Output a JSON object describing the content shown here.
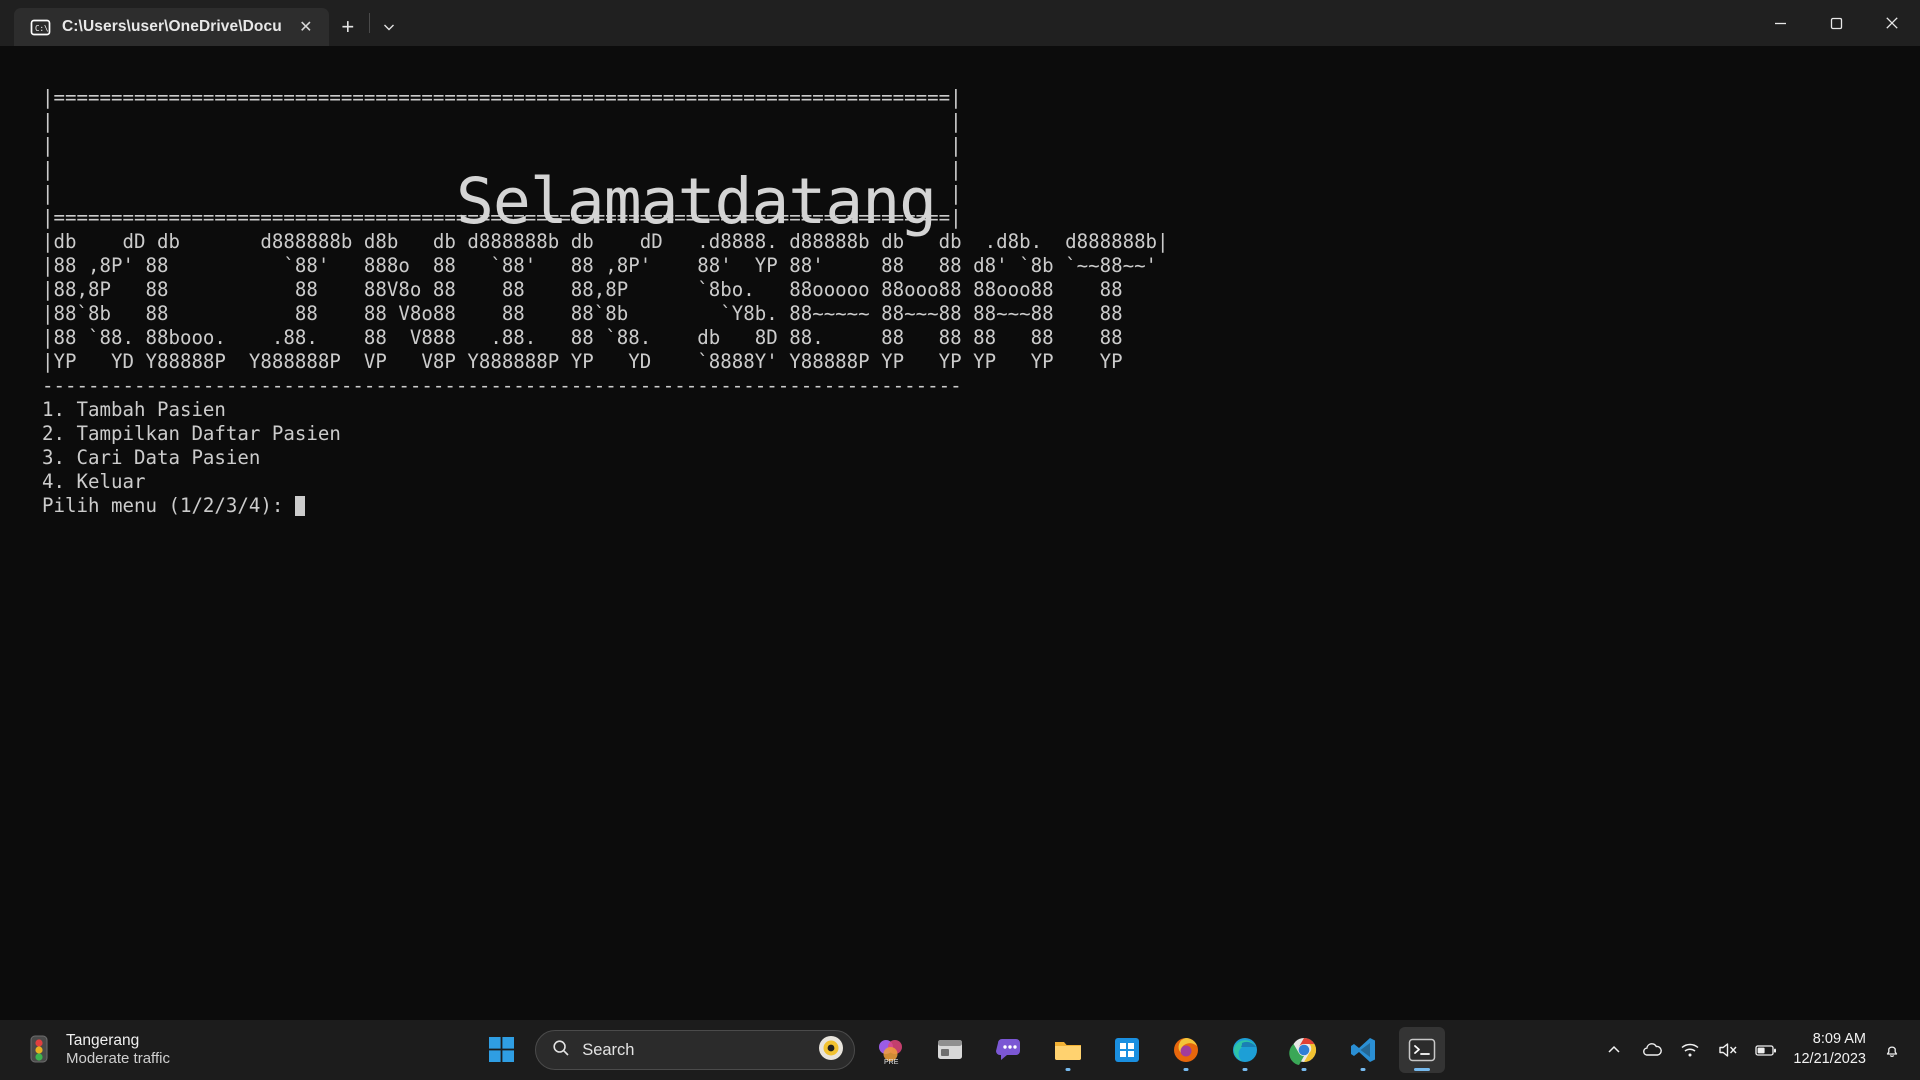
{
  "window": {
    "tab_title": "C:\\Users\\user\\OneDrive\\Docu",
    "tab_icon": "command-prompt-icon",
    "close_glyph": "✕",
    "newtab_glyph": "+",
    "dropdown_glyph": "⌄",
    "minimize_glyph": "─",
    "maximize_glyph": "☐",
    "winclose_glyph": "✕"
  },
  "terminal": {
    "background": "#0c0c0c",
    "foreground": "#cccccc",
    "banner_title": "Selamatdatang",
    "top_border": "|==============================================================================|",
    "blank_row": "|                                                                              |",
    "mid_border": "|==============================================================================|",
    "ascii_rows": [
      "|db    dD db       d888888b d8b   db d888888b db    dD   .d8888. d88888b db   db  .d8b.  d888888b|",
      "|88 ,8P' 88          `88'   888o  88   `88'   88 ,8P'    88'  YP 88'     88   88 d8' `8b `~~88~~'",
      "|88,8P   88           88    88V8o 88    88    88,8P      `8bo.   88ooooo 88ooo88 88ooo88    88   ",
      "|88`8b   88           88    88 V8o88    88    88`8b        `Y8b. 88~~~~~ 88~~~88 88~~~88    88   ",
      "|88 `88. 88booo.    .88.    88  V888   .88.   88 `88.    db   8D 88.     88   88 88   88    88   ",
      "|YP   YD Y88888P  Y888888P  VP   V8P Y888888P YP   YD    `8888Y' Y88888P YP   YP YP   YP    YP   "
    ],
    "separator": "--------------------------------------------------------------------------------",
    "menu_items": [
      "1. Tambah Pasien",
      "2. Tampilkan Daftar Pasien",
      "3. Cari Data Pasien",
      "4. Keluar"
    ],
    "prompt": "Pilih menu (1/2/3/4): "
  },
  "taskbar": {
    "weather": {
      "city": "Tangerang",
      "condition": "Moderate traffic",
      "icon": "traffic-light-icon"
    },
    "start_icon": "windows-start-icon",
    "search": {
      "placeholder": "Search",
      "icon": "search-icon",
      "assistant_icon": "copilot-icon"
    },
    "apps": [
      {
        "name": "adobe-premiere-icon",
        "label": "PRE",
        "state": "pinned"
      },
      {
        "name": "widgets-icon",
        "label": "Widgets",
        "state": "pinned"
      },
      {
        "name": "chat-icon",
        "label": "Chat",
        "state": "pinned"
      },
      {
        "name": "file-explorer-icon",
        "label": "File Explorer",
        "state": "pinned"
      },
      {
        "name": "microsoft-store-icon",
        "label": "Microsoft Store",
        "state": "pinned"
      },
      {
        "name": "firefox-icon",
        "label": "Firefox",
        "state": "open"
      },
      {
        "name": "microsoft-edge-icon",
        "label": "Microsoft Edge",
        "state": "open"
      },
      {
        "name": "google-chrome-icon",
        "label": "Google Chrome",
        "state": "open"
      },
      {
        "name": "vs-code-icon",
        "label": "Visual Studio Code",
        "state": "open"
      },
      {
        "name": "windows-terminal-icon",
        "label": "Windows Terminal",
        "state": "active"
      }
    ],
    "tray": [
      {
        "name": "show-hidden-icons-chevron",
        "glyph": "⌃"
      },
      {
        "name": "onedrive-cloud-icon"
      },
      {
        "name": "wifi-icon"
      },
      {
        "name": "speaker-muted-icon"
      },
      {
        "name": "battery-icon"
      }
    ],
    "clock": {
      "time": "8:09 AM",
      "date": "12/21/2023"
    },
    "notification_icon": "bell-icon"
  },
  "colors": {
    "accent": "#76b9ed",
    "titlebar": "#202020",
    "tab_active": "#2d2d2d",
    "taskbar": "#1c1c1c"
  }
}
